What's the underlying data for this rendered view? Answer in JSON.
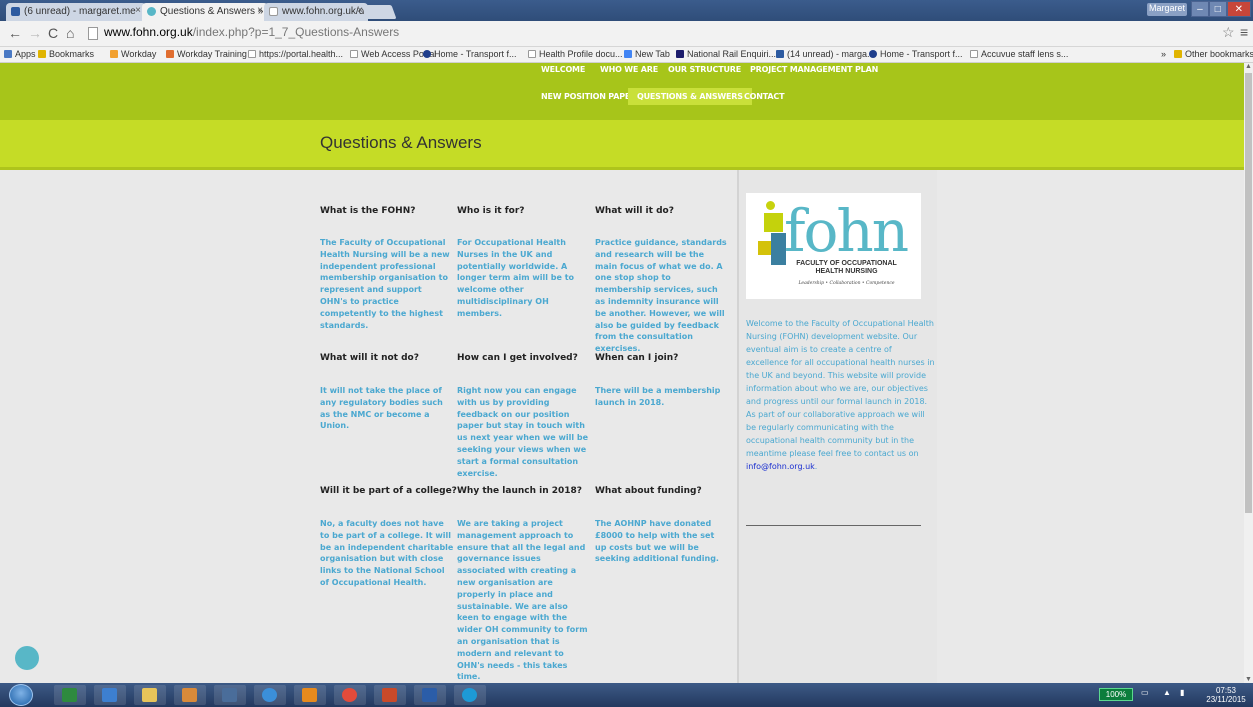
{
  "browser": {
    "tabs": [
      {
        "label": "(6 unread) - margaret.me"
      },
      {
        "label": "Questions & Answers » Th"
      },
      {
        "label": "www.fohn.org.uk/data/file"
      }
    ],
    "window_user": "Margaret",
    "url_domain": "www.fohn.org.uk",
    "url_path": "/index.php?p=1_7_Questions-Answers",
    "bookmarks": [
      "Apps",
      "Bookmarks",
      "Workday",
      "Workday Training",
      "https://portal.health...",
      "Web Access Portal",
      "Home - Transport f...",
      "Health Profile docu...",
      "New Tab",
      "National Rail Enquiri...",
      "(14 unread) - marga...",
      "Home - Transport f...",
      "Accuvue staff lens s...",
      "»",
      "Other bookmarks"
    ]
  },
  "nav": {
    "row1": [
      "WELCOME",
      "WHO WE ARE",
      "OUR STRUCTURE",
      "PROJECT MANAGEMENT PLAN"
    ],
    "row2": [
      "NEW POSITION PAPER",
      "QUESTIONS & ANSWERS",
      "CONTACT"
    ]
  },
  "page": {
    "title": "Questions & Answers"
  },
  "qa": [
    {
      "q": "What is the FOHN?",
      "a": "The Faculty of Occupational Health Nursing will be a new independent professional membership organisation to represent and support OHN's to practice competently to the highest standards."
    },
    {
      "q": "Who is it for?",
      "a": "For Occupational Health Nurses in the UK and potentially worldwide. A longer term aim will be to welcome other multidisciplinary OH members."
    },
    {
      "q": "What will it do?",
      "a": "Practice guidance, standards and research will be the main focus of what we do. A one stop shop to membership services, such as indemnity insurance will be another. However, we will also be guided by feedback from the consultation exercises."
    },
    {
      "q": "What will it not do?",
      "a": "It will not take the place of any regulatory bodies such as the NMC or become a Union."
    },
    {
      "q": "How can I get involved?",
      "a": "Right now you can engage with us by providing feedback on our position paper but stay in touch with us next year when we will be seeking your views when we start a formal consultation exercise."
    },
    {
      "q": "When can I join?",
      "a": "There will be a membership launch in 2018."
    },
    {
      "q": "Will it be part of a college?",
      "a": "No, a faculty does not have to be part of a college. It will be an independent charitable organisation but with close links to the National School of Occupational Health."
    },
    {
      "q": "Why the launch in 2018?",
      "a": "We are taking a project management approach to ensure that all the legal and governance issues associated with creating a new organisation are properly in place and sustainable. We are also keen to engage with the wider OH community to form an organisation that is modern and relevant to OHN's needs - this takes time."
    },
    {
      "q": "What about funding?",
      "a": "The AOHNP have donated £8000 to help with the set up costs but we will be seeking additional funding."
    }
  ],
  "sidebar": {
    "logo_word": "fohn",
    "logo_subtitle_1": "FACULTY OF OCCUPATIONAL",
    "logo_subtitle_2": "HEALTH NURSING",
    "logo_tagline": "Leadership • Collaboration • Competence",
    "welcome_text": "Welcome to the Faculty of Occupational Health Nursing (FOHN) development website. Our eventual aim is to create a centre of excellence for all occupational health nurses in the UK and beyond. This website will provide information about who we are, our objectives and progress until our formal launch in 2018. As part of our collaborative approach we will be regularly communicating with the occupational health community but in the meantime please feel free to contact us on",
    "email": "info@fohn.org.uk",
    "email_suffix": "."
  },
  "taskbar": {
    "zoom": "100%",
    "time": "07:53",
    "date": "23/11/2015"
  },
  "colors": {
    "nav_green": "#a7c51a",
    "title_band": "#c5dc26",
    "answer_blue": "#4ba8d0",
    "brand_teal": "#58b7c7"
  }
}
